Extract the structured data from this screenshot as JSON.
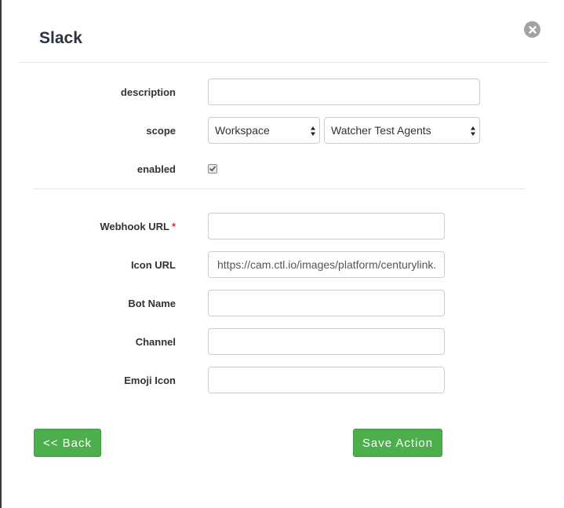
{
  "dialog": {
    "title": "Slack"
  },
  "general": {
    "description_label": "description",
    "description_value": "",
    "scope_label": "scope",
    "scope_type_selected": "Workspace",
    "scope_target_selected": "Watcher Test Agents",
    "enabled_label": "enabled",
    "enabled_checked": true
  },
  "config": {
    "webhook_label": "Webhook URL",
    "webhook_required_mark": "*",
    "webhook_value": "",
    "icon_url_label": "Icon URL",
    "icon_url_value": "https://cam.ctl.io/images/platform/centurylink.png",
    "bot_name_label": "Bot Name",
    "bot_name_value": "",
    "channel_label": "Channel",
    "channel_value": "",
    "emoji_icon_label": "Emoji Icon",
    "emoji_icon_value": ""
  },
  "actions": {
    "back_label": "<< Back",
    "save_label": "Save Action"
  },
  "icons": {
    "close": "close-circle-icon",
    "select_arrows": "up-down-arrows-icon",
    "check": "checkmark-icon"
  },
  "colors": {
    "primary_button": "#4cae4c",
    "required": "#d9302c",
    "title": "#2a3340"
  }
}
